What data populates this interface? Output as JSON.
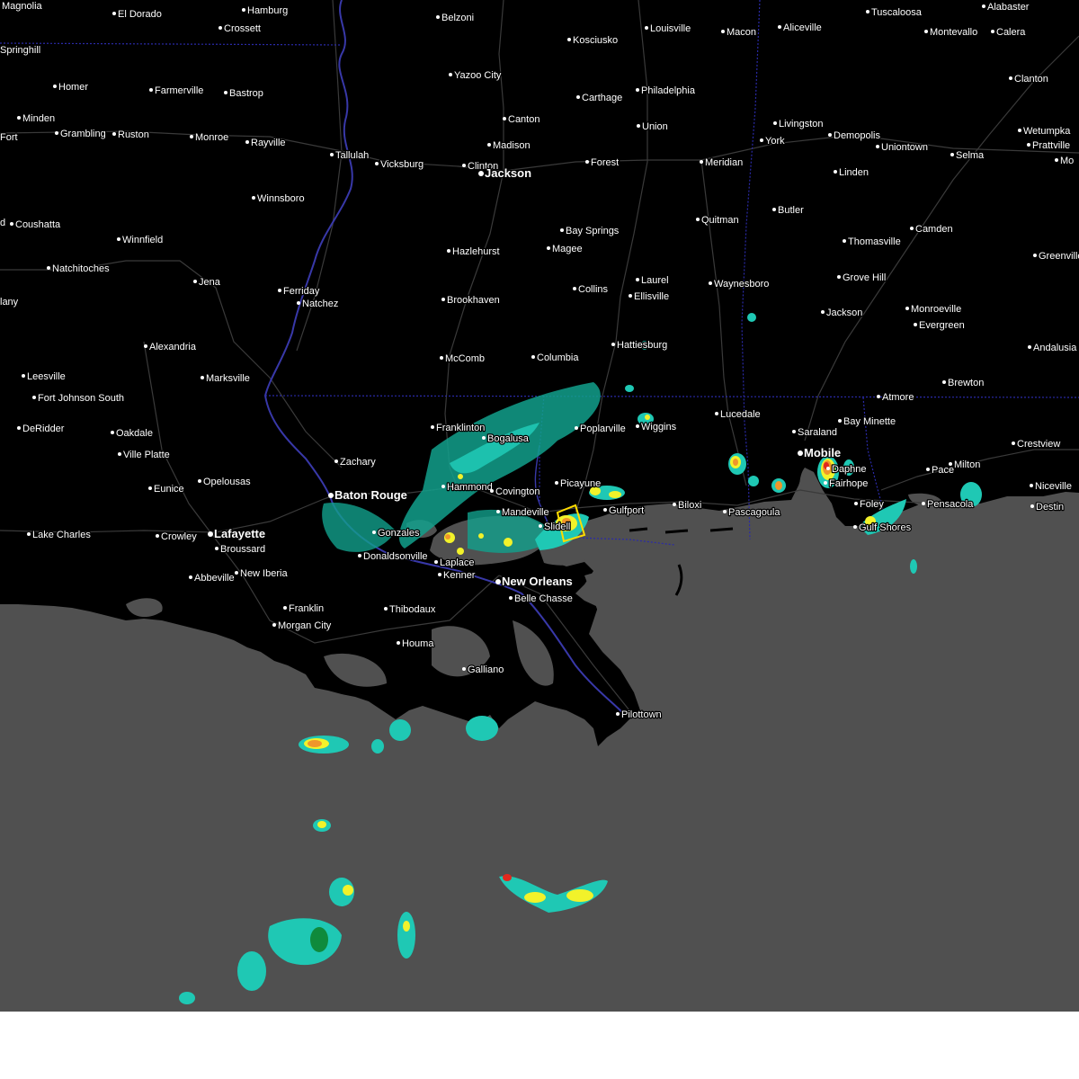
{
  "map": {
    "colors": {
      "land": "#000000",
      "water": "#505050",
      "roads": "#3a3a3a",
      "state_border": "#2a2aa8",
      "river": "#3838a8",
      "radar_light": "#12a08c",
      "radar_teal": "#1fc8b4",
      "radar_green": "#0f8a3c",
      "radar_yellow": "#f2f22a",
      "radar_orange": "#f0962a",
      "radar_red": "#e0281e",
      "warning_box": "#ffdc00",
      "below_map": "#ffffff"
    },
    "cities": [
      {
        "name": "Magnolia",
        "major": false
      },
      {
        "name": "El Dorado",
        "major": false
      },
      {
        "name": "Hamburg",
        "major": false
      },
      {
        "name": "Crossett",
        "major": false
      },
      {
        "name": "Belzoni",
        "major": false
      },
      {
        "name": "Kosciusko",
        "major": false
      },
      {
        "name": "Louisville",
        "major": false
      },
      {
        "name": "Macon",
        "major": false
      },
      {
        "name": "Aliceville",
        "major": false
      },
      {
        "name": "Tuscaloosa",
        "major": false
      },
      {
        "name": "Alabaster",
        "major": false
      },
      {
        "name": "Springhill",
        "major": false
      },
      {
        "name": "Montevallo",
        "major": false
      },
      {
        "name": "Calera",
        "major": false
      },
      {
        "name": "Yazoo City",
        "major": false
      },
      {
        "name": "Homer",
        "major": false
      },
      {
        "name": "Farmerville",
        "major": false
      },
      {
        "name": "Bastrop",
        "major": false
      },
      {
        "name": "Philadelphia",
        "major": false
      },
      {
        "name": "Carthage",
        "major": false
      },
      {
        "name": "Clanton",
        "major": false
      },
      {
        "name": "Minden",
        "major": false
      },
      {
        "name": "Canton",
        "major": false
      },
      {
        "name": "Livingston",
        "major": false
      },
      {
        "name": "Union",
        "major": false
      },
      {
        "name": "Wetumpka",
        "major": false
      },
      {
        "name": "Grambling",
        "major": false
      },
      {
        "name": "Ruston",
        "major": false
      },
      {
        "name": "Monroe",
        "major": false
      },
      {
        "name": "Rayville",
        "major": false
      },
      {
        "name": "Demopolis",
        "major": false
      },
      {
        "name": "York",
        "major": false
      },
      {
        "name": "Prattville",
        "major": false
      },
      {
        "name": "Madison",
        "major": false
      },
      {
        "name": "Uniontown",
        "major": false
      },
      {
        "name": "Tallulah",
        "major": false
      },
      {
        "name": "Selma",
        "major": false
      },
      {
        "name": "Vicksburg",
        "major": false
      },
      {
        "name": "Clinton",
        "major": false
      },
      {
        "name": "Jackson",
        "major": true
      },
      {
        "name": "Forest",
        "major": false
      },
      {
        "name": "Meridian",
        "major": false
      },
      {
        "name": "Linden",
        "major": false
      },
      {
        "name": "Winnsboro",
        "major": false
      },
      {
        "name": "Butler",
        "major": false
      },
      {
        "name": "Quitman",
        "major": false
      },
      {
        "name": "Coushatta",
        "major": false
      },
      {
        "name": "Bay Springs",
        "major": false
      },
      {
        "name": "Camden",
        "major": false
      },
      {
        "name": "Winnfield",
        "major": false
      },
      {
        "name": "Thomasville",
        "major": false
      },
      {
        "name": "Hazlehurst",
        "major": false
      },
      {
        "name": "Magee",
        "major": false
      },
      {
        "name": "Greenville",
        "major": false
      },
      {
        "name": "Natchitoches",
        "major": false
      },
      {
        "name": "Grove Hill",
        "major": false
      },
      {
        "name": "Laurel",
        "major": false
      },
      {
        "name": "Jena",
        "major": false
      },
      {
        "name": "Waynesboro",
        "major": false
      },
      {
        "name": "Ferriday",
        "major": false
      },
      {
        "name": "Collins",
        "major": false
      },
      {
        "name": "Ellisville",
        "major": false
      },
      {
        "name": "Natchez",
        "major": false
      },
      {
        "name": "Brookhaven",
        "major": false
      },
      {
        "name": "Monroeville",
        "major": false
      },
      {
        "name": "Jackson",
        "major": false
      },
      {
        "name": "Evergreen",
        "major": false
      },
      {
        "name": "Alexandria",
        "major": false
      },
      {
        "name": "Hattiesburg",
        "major": false
      },
      {
        "name": "Andalusia",
        "major": false
      },
      {
        "name": "McComb",
        "major": false
      },
      {
        "name": "Columbia",
        "major": false
      },
      {
        "name": "Leesville",
        "major": false
      },
      {
        "name": "Marksville",
        "major": false
      },
      {
        "name": "Brewton",
        "major": false
      },
      {
        "name": "Fort Johnson South",
        "major": false
      },
      {
        "name": "Atmore",
        "major": false
      },
      {
        "name": "Lucedale",
        "major": false
      },
      {
        "name": "Bay Minette",
        "major": false
      },
      {
        "name": "Franklinton",
        "major": false
      },
      {
        "name": "DeRidder",
        "major": false
      },
      {
        "name": "Poplarville",
        "major": false
      },
      {
        "name": "Wiggins",
        "major": false
      },
      {
        "name": "Oakdale",
        "major": false
      },
      {
        "name": "Saraland",
        "major": false
      },
      {
        "name": "Crestview",
        "major": false
      },
      {
        "name": "Bogalusa",
        "major": false
      },
      {
        "name": "Ville Platte",
        "major": false
      },
      {
        "name": "Mobile",
        "major": true
      },
      {
        "name": "Zachary",
        "major": false
      },
      {
        "name": "Milton",
        "major": false
      },
      {
        "name": "Pace",
        "major": false
      },
      {
        "name": "Daphne",
        "major": false
      },
      {
        "name": "Opelousas",
        "major": false
      },
      {
        "name": "Picayune",
        "major": false
      },
      {
        "name": "Hammond",
        "major": false
      },
      {
        "name": "Fairhope",
        "major": false
      },
      {
        "name": "Eunice",
        "major": false
      },
      {
        "name": "Covington",
        "major": false
      },
      {
        "name": "Niceville",
        "major": false
      },
      {
        "name": "Baton Rouge",
        "major": true
      },
      {
        "name": "Biloxi",
        "major": false
      },
      {
        "name": "Gulfport",
        "major": false
      },
      {
        "name": "Foley",
        "major": false
      },
      {
        "name": "Pensacola",
        "major": false
      },
      {
        "name": "Destin",
        "major": false
      },
      {
        "name": "Mandeville",
        "major": false
      },
      {
        "name": "Pascagoula",
        "major": false
      },
      {
        "name": "Slidell",
        "major": false
      },
      {
        "name": "Gulf Shores",
        "major": false
      },
      {
        "name": "Lake Charles",
        "major": false
      },
      {
        "name": "Crowley",
        "major": false
      },
      {
        "name": "Lafayette",
        "major": true
      },
      {
        "name": "Gonzales",
        "major": false
      },
      {
        "name": "Broussard",
        "major": false
      },
      {
        "name": "Donaldsonville",
        "major": false
      },
      {
        "name": "Laplace",
        "major": false
      },
      {
        "name": "New Iberia",
        "major": false
      },
      {
        "name": "Abbeville",
        "major": false
      },
      {
        "name": "Kenner",
        "major": false
      },
      {
        "name": "New Orleans",
        "major": true
      },
      {
        "name": "Belle Chasse",
        "major": false
      },
      {
        "name": "Franklin",
        "major": false
      },
      {
        "name": "Thibodaux",
        "major": false
      },
      {
        "name": "Morgan City",
        "major": false
      },
      {
        "name": "Houma",
        "major": false
      },
      {
        "name": "Galliano",
        "major": false
      },
      {
        "name": "Pilottown",
        "major": false
      },
      {
        "name": "Fort",
        "major": false
      },
      {
        "name": "Mo",
        "major": false
      },
      {
        "name": "lany",
        "major": false
      },
      {
        "name": "d",
        "major": false
      }
    ]
  }
}
